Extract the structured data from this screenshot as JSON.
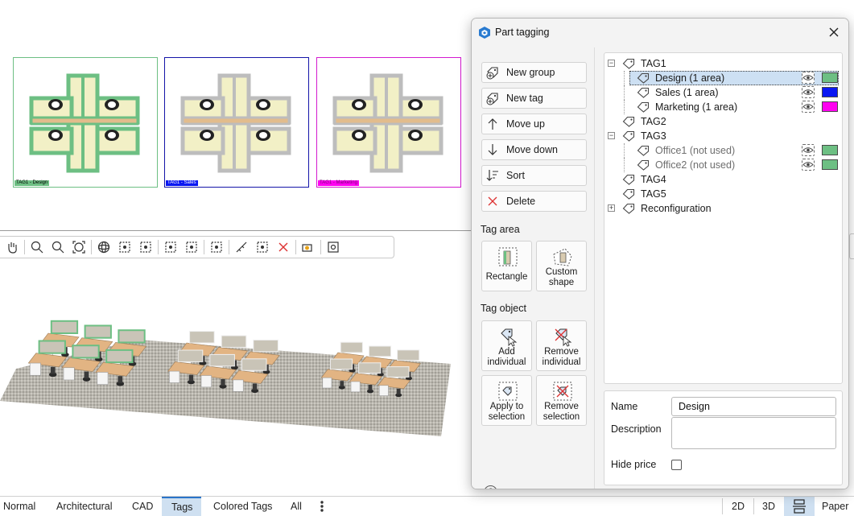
{
  "colors": {
    "accent": "#2a74c9",
    "tag_design": "#6dbf83",
    "tag_sales": "#0a17f2",
    "tag_marketing": "#ff00f0",
    "tag_office": "#6dbf83"
  },
  "thumbnails": [
    {
      "label": "TAG1 - Design",
      "border": "#6dbf83",
      "label_bg": "#6dbf83"
    },
    {
      "label": "TAG1 - Sales",
      "border": "#1414a8",
      "label_bg": "#0a17f2"
    },
    {
      "label": "TAG1 - Marketing",
      "border": "#d41ad0",
      "label_bg": "#ff00f0"
    }
  ],
  "toolbar_icons": [
    "hand-icon",
    "zoom-in-icon",
    "zoom-out-icon",
    "zoom-fit-icon",
    "orbit-icon",
    "zoom-extents-icon",
    "zoom-object-icon",
    "select-zoom-icon",
    "select-list-icon",
    "dimension-icon",
    "measure-icon",
    "copy-icon",
    "delete-icon",
    "camera-icon",
    "target-icon"
  ],
  "view_tabs": [
    {
      "label": "Normal"
    },
    {
      "label": "Architectural"
    },
    {
      "label": "CAD"
    },
    {
      "label": "Tags",
      "active": true
    },
    {
      "label": "Colored Tags"
    },
    {
      "label": "All"
    }
  ],
  "modes": {
    "two_d": "2D",
    "three_d": "3D",
    "paper": "Paper"
  },
  "dialog": {
    "title": "Part tagging",
    "commands": {
      "new_group": "New group",
      "new_tag": "New tag",
      "move_up": "Move up",
      "move_down": "Move down",
      "sort": "Sort",
      "delete": "Delete"
    },
    "tag_area": {
      "heading": "Tag area",
      "rectangle": "Rectangle",
      "custom_shape_1": "Custom",
      "custom_shape_2": "shape"
    },
    "tag_object": {
      "heading": "Tag object",
      "add_1": "Add",
      "add_2": "individual",
      "remove_1": "Remove",
      "remove_2": "individual",
      "apply_1": "Apply to",
      "apply_2": "selection",
      "remsel_1": "Remove",
      "remsel_2": "selection"
    },
    "tree": [
      {
        "label": "TAG1",
        "level": 0,
        "expander": "−"
      },
      {
        "label": "Design (1 area)",
        "level": 1,
        "selected": true,
        "color": "#6dbf83"
      },
      {
        "label": "Sales (1 area)",
        "level": 1,
        "color": "#0a17f2"
      },
      {
        "label": "Marketing (1 area)",
        "level": 1,
        "color": "#ff00f0"
      },
      {
        "label": "TAG2",
        "level": 0
      },
      {
        "label": "TAG3",
        "level": 0,
        "expander": "−"
      },
      {
        "label": "Office1 (not used)",
        "level": 1,
        "muted": true,
        "color": "#6dbf83"
      },
      {
        "label": "Office2 (not used)",
        "level": 1,
        "muted": true,
        "color": "#6dbf83"
      },
      {
        "label": "TAG4",
        "level": 0
      },
      {
        "label": "TAG5",
        "level": 0
      },
      {
        "label": "Reconfiguration",
        "level": 0,
        "expander": "+"
      }
    ],
    "properties": {
      "name_label": "Name",
      "name_value": "Design",
      "description_label": "Description",
      "description_value": "",
      "hide_price_label": "Hide price",
      "hide_price_checked": false
    },
    "help": "?"
  }
}
